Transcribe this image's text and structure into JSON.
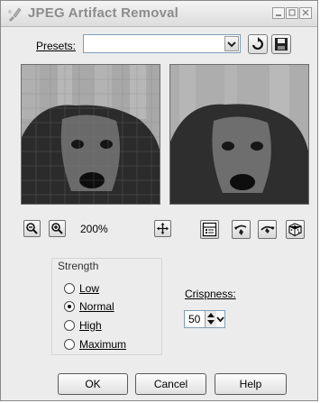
{
  "window": {
    "title": "JPEG Artifact Removal"
  },
  "presets": {
    "label": "Presets:",
    "value": ""
  },
  "zoom": {
    "level": "200%"
  },
  "strength": {
    "title": "Strength",
    "options": [
      {
        "label": "Low",
        "checked": false
      },
      {
        "label": "Normal",
        "checked": true
      },
      {
        "label": "High",
        "checked": false
      },
      {
        "label": "Maximum",
        "checked": false
      }
    ]
  },
  "crispness": {
    "label": "Crispness:",
    "value": "50"
  },
  "buttons": {
    "ok": "OK",
    "cancel": "Cancel",
    "help": "Help"
  },
  "icons": {
    "app": "paint-brush-icon",
    "zoom_out": "zoom-out-icon",
    "zoom_in": "zoom-in-icon",
    "pan": "move-icon",
    "proof": "proof-toggle-icon",
    "reset": "reset-default-icon",
    "randomize": "dice-icon",
    "save_preset": "floppy-save-icon",
    "load_preset": "reset-arrow-icon"
  }
}
